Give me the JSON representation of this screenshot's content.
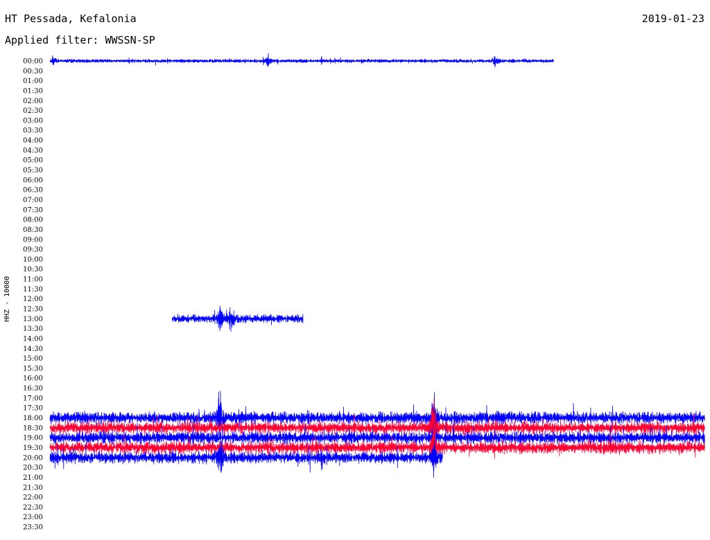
{
  "header": {
    "station": "HT Pessada, Kefalonia",
    "date": "2019-01-23",
    "filter": "Applied filter: WWSSN-SP"
  },
  "chart_data": {
    "type": "line",
    "title": "HT Pessada, Kefalonia",
    "subtitle": "Applied filter: WWSSN-SP",
    "ylabel": "HHZ - 10000",
    "xlabel": "",
    "x_unit": "minutes",
    "x_range": [
      0,
      30
    ],
    "y_tick_labels": [
      "00:00",
      "00:30",
      "01:00",
      "01:30",
      "02:00",
      "02:30",
      "03:00",
      "03:30",
      "04:00",
      "04:30",
      "05:00",
      "05:30",
      "06:00",
      "06:30",
      "07:00",
      "07:30",
      "08:00",
      "08:30",
      "09:00",
      "09:30",
      "10:00",
      "10:30",
      "11:00",
      "11:30",
      "12:00",
      "12:30",
      "13:00",
      "13:30",
      "14:00",
      "14:30",
      "15:00",
      "15:30",
      "16:00",
      "16:30",
      "17:00",
      "17:30",
      "18:00",
      "18:30",
      "19:00",
      "19:30",
      "20:00",
      "20:30",
      "21:00",
      "21:30",
      "22:00",
      "22:30",
      "23:00",
      "23:30"
    ],
    "colors": {
      "blue": "#0000ff",
      "red": "#ff0033"
    },
    "series": [
      {
        "row": "00:00",
        "start_min": 0.0,
        "end_min": 23.1,
        "color": "blue",
        "amp": 2.2,
        "seed": 11,
        "events": [
          {
            "at_min": 10.0,
            "amp": 11
          },
          {
            "at_min": 20.4,
            "amp": 9
          },
          {
            "at_min": 0.15,
            "amp": 8
          }
        ]
      },
      {
        "row": "13:00",
        "start_min": 5.6,
        "end_min": 11.6,
        "color": "blue",
        "amp": 5,
        "seed": 23,
        "events": [
          {
            "at_min": 7.8,
            "amp": 22
          },
          {
            "at_min": 8.3,
            "amp": 24
          }
        ]
      },
      {
        "row": "18:00",
        "start_min": 0.0,
        "end_min": 30.0,
        "color": "blue",
        "amp": 7,
        "seed": 31,
        "events": [
          {
            "at_min": 7.8,
            "amp": 55
          },
          {
            "at_min": 17.6,
            "amp": 40
          }
        ]
      },
      {
        "row": "18:30",
        "start_min": 0.0,
        "end_min": 30.0,
        "color": "red",
        "amp": 7,
        "seed": 37,
        "events": [
          {
            "at_min": 17.6,
            "amp": 60
          }
        ]
      },
      {
        "row": "19:00",
        "start_min": 0.0,
        "end_min": 30.0,
        "color": "blue",
        "amp": 7,
        "seed": 41,
        "events": [
          {
            "at_min": 17.6,
            "amp": 30
          }
        ]
      },
      {
        "row": "19:30",
        "start_min": 0.0,
        "end_min": 30.0,
        "color": "red",
        "amp": 7,
        "seed": 43,
        "events": [
          {
            "at_min": 17.6,
            "amp": 45
          }
        ]
      },
      {
        "row": "20:00",
        "start_min": 0.0,
        "end_min": 18.0,
        "color": "blue",
        "amp": 7,
        "seed": 47,
        "events": [
          {
            "at_min": 7.8,
            "amp": 45
          },
          {
            "at_min": 17.6,
            "amp": 30
          }
        ]
      }
    ]
  }
}
